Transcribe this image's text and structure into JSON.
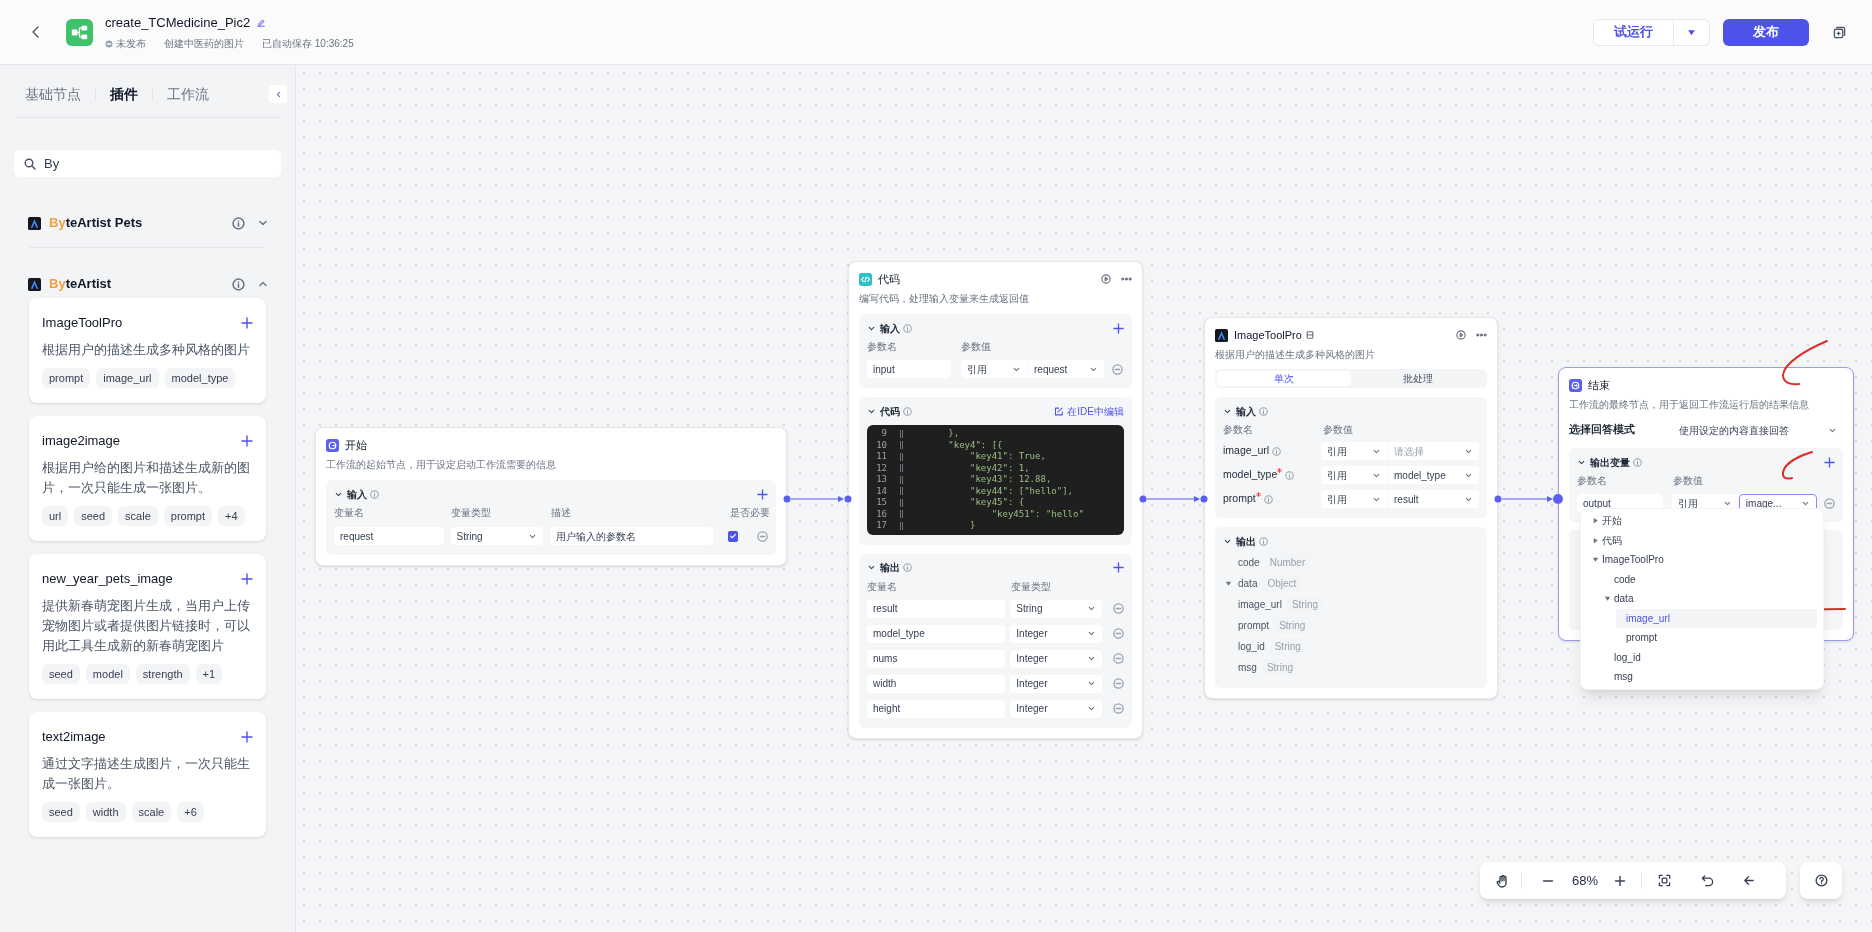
{
  "header": {
    "title": "create_TCMedicine_Pic2",
    "status": "未发布",
    "description": "创建中医药的图片",
    "autosave": "已自动保存 10:36:25",
    "test_run": "试运行",
    "publish": "发布"
  },
  "sidebar": {
    "tabs": [
      {
        "label": "基础节点",
        "selected": false
      },
      {
        "label": "插件",
        "selected": true
      },
      {
        "label": "工作流",
        "selected": false
      }
    ],
    "search": {
      "value": "By"
    },
    "plugins": [
      {
        "name_parts": [
          "By",
          "teArtist Pets"
        ],
        "expanded": false
      },
      {
        "name_parts": [
          "By",
          "teArtist"
        ],
        "expanded": true,
        "tools": [
          {
            "name": "ImageToolPro",
            "description": "根据用户的描述生成多种风格的图片",
            "tags": [
              "prompt",
              "image_url",
              "model_type"
            ]
          },
          {
            "name": "image2image",
            "description": "根据用户给的图片和描述生成新的图片，一次只能生成一张图片。",
            "tags": [
              "url",
              "seed",
              "scale",
              "prompt",
              "+4"
            ]
          },
          {
            "name": "new_year_pets_image",
            "description": "提供新春萌宠图片生成，当用户上传宠物图片或者提供图片链接时，可以用此工具生成新的新春萌宠图片",
            "tags": [
              "seed",
              "model",
              "strength",
              "+1"
            ]
          },
          {
            "name": "text2image",
            "description": "通过文字描述生成图片，一次只能生成一张图片。",
            "tags": [
              "seed",
              "width",
              "scale",
              "+6"
            ]
          }
        ]
      }
    ]
  },
  "canvas": {
    "nodes": [
      {
        "kind": "start",
        "selected": false,
        "title": "开始",
        "description": "工作流的起始节点，用于设定启动工作流需要的信息",
        "inputs": {
          "label": "输入",
          "columns": [
            "变量名",
            "变量类型",
            "描述",
            "是否必要"
          ],
          "rows": [
            {
              "name": "request",
              "type": "String",
              "description": "用户输入的参数名",
              "required": true
            }
          ]
        }
      },
      {
        "kind": "code",
        "selected": false,
        "title": "代码",
        "description": "编写代码，处理输入变量来生成返回值",
        "inputs": {
          "label": "输入",
          "columns": [
            "参数名",
            "参数值"
          ],
          "rows": [
            {
              "name": "input",
              "source": "引用",
              "value": "request"
            }
          ]
        },
        "code": {
          "label": "代码",
          "ide_link": "在IDE中编辑",
          "lines": [
            {
              "number": "9",
              "text": "        },"
            },
            {
              "number": "10",
              "text": "        \"key4\": [{"
            },
            {
              "number": "11",
              "text": "            \"key41\": True,"
            },
            {
              "number": "12",
              "text": "            \"key42\": 1,"
            },
            {
              "number": "13",
              "text": "            \"key43\": 12.88,"
            },
            {
              "number": "14",
              "text": "            \"key44\": [\"hello\"],"
            },
            {
              "number": "15",
              "text": "            \"key45\": {"
            },
            {
              "number": "16",
              "text": "                \"key451\": \"hello\""
            },
            {
              "number": "17",
              "text": "            }"
            }
          ]
        },
        "outputs": {
          "label": "输出",
          "columns": [
            "变量名",
            "变量类型"
          ],
          "rows": [
            {
              "name": "result",
              "type": "String"
            },
            {
              "name": "model_type",
              "type": "Integer"
            },
            {
              "name": "nums",
              "type": "Integer"
            },
            {
              "name": "width",
              "type": "Integer"
            },
            {
              "name": "height",
              "type": "Integer"
            }
          ]
        }
      },
      {
        "kind": "plugin",
        "selected": false,
        "title": "ImageToolPro",
        "description": "根据用户的描述生成多种风格的图片",
        "modes": [
          {
            "label": "单次",
            "selected": true
          },
          {
            "label": "批处理",
            "selected": false
          }
        ],
        "inputs": {
          "label": "输入",
          "columns": [
            "参数名",
            "参数值"
          ],
          "rows": [
            {
              "name": "image_url",
              "required": false,
              "source": "引用",
              "placeholder": "请选择"
            },
            {
              "name": "model_type",
              "required": true,
              "source": "引用",
              "value": "model_type"
            },
            {
              "name": "prompt",
              "required": true,
              "source": "引用",
              "value": "result"
            }
          ]
        },
        "outputs": {
          "label": "输出",
          "fields": [
            {
              "name": "code",
              "type": "Number"
            },
            {
              "name": "data",
              "type": "Object",
              "expanded": true,
              "children": [
                {
                  "name": "image_url",
                  "type": "String"
                },
                {
                  "name": "prompt",
                  "type": "String"
                }
              ]
            },
            {
              "name": "log_id",
              "type": "String"
            },
            {
              "name": "msg",
              "type": "String"
            }
          ]
        }
      },
      {
        "kind": "end",
        "selected": true,
        "title": "结束",
        "description": "工作流的最终节点，用于返回工作流运行后的结果信息",
        "answer_mode": {
          "label": "选择回答模式",
          "value": "使用设定的内容直接回答"
        },
        "outputs": {
          "label": "输出变量",
          "columns": [
            "参数名",
            "参数值"
          ],
          "rows": [
            {
              "name": "output",
              "source": "引用",
              "value": "image...",
              "focused": true
            }
          ]
        },
        "variable_menu": [
          {
            "label": "开始",
            "expanded": false,
            "selected": false
          },
          {
            "label": "代码",
            "expanded": false,
            "selected": false
          },
          {
            "label": "ImageToolPro",
            "expanded": true,
            "selected": false,
            "children": [
              {
                "label": "code",
                "selected": false
              },
              {
                "label": "data",
                "expanded": true,
                "selected": false,
                "children": [
                  {
                    "label": "image_url",
                    "selected": true
                  },
                  {
                    "label": "prompt",
                    "selected": false
                  }
                ]
              },
              {
                "label": "log_id",
                "selected": false
              },
              {
                "label": "msg",
                "selected": false
              }
            ]
          }
        ]
      }
    ],
    "zoom": "68%"
  }
}
